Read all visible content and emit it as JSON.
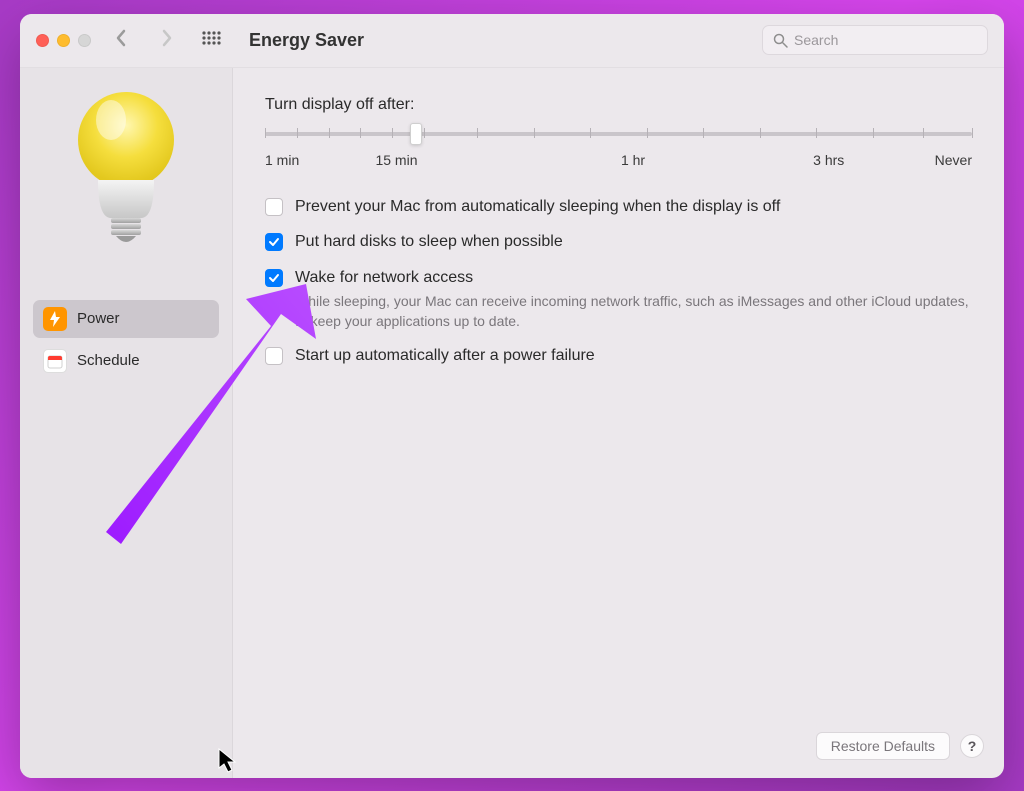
{
  "header": {
    "title": "Energy Saver",
    "search_placeholder": "Search"
  },
  "sidebar": {
    "items": [
      {
        "label": "Power"
      },
      {
        "label": "Schedule"
      }
    ]
  },
  "slider": {
    "label": "Turn display off after:",
    "scale": [
      "1 min",
      "15 min",
      "1 hr",
      "3 hrs",
      "Never"
    ]
  },
  "options": {
    "prevent_sleep": "Prevent your Mac from automatically sleeping when the display is off",
    "hard_disks": "Put hard disks to sleep when possible",
    "wake_network": "Wake for network access",
    "wake_network_desc": "While sleeping, your Mac can receive incoming network traffic, such as iMessages and other iCloud updates, to keep your applications up to date.",
    "startup_failure": "Start up automatically after a power failure"
  },
  "footer": {
    "restore": "Restore Defaults",
    "help": "?"
  }
}
